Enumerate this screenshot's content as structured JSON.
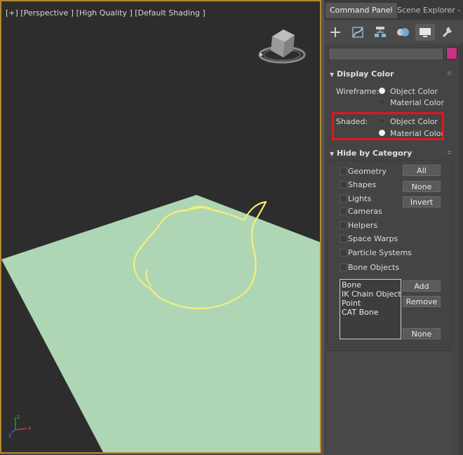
{
  "viewport": {
    "label": "[+] [Perspective ] [High Quality ] [Default Shading ]",
    "colors": {
      "background": "#2d2d2d",
      "ground_plane": "#aed6b4",
      "wire_outline": "#f2ef7a",
      "frame": "#b08a2e"
    },
    "axes": {
      "x": "x",
      "y": "y",
      "z": "z"
    }
  },
  "panel": {
    "tabs": [
      {
        "label": "Command Panel",
        "active": true
      },
      {
        "label": "Scene Explorer - De",
        "active": false
      }
    ],
    "tools": [
      {
        "icon": "create-icon"
      },
      {
        "icon": "modify-icon"
      },
      {
        "icon": "hierarchy-icon"
      },
      {
        "icon": "motion-icon"
      },
      {
        "icon": "display-icon",
        "active": true
      },
      {
        "icon": "utilities-icon"
      }
    ],
    "object_color": "#c2347f",
    "display_color": {
      "title": "Display Color",
      "wireframe_label": "Wireframe:",
      "wireframe_options": [
        {
          "label": "Object Color",
          "selected": true
        },
        {
          "label": "Material Color",
          "selected": false
        }
      ],
      "shaded_label": "Shaded:",
      "shaded_options": [
        {
          "label": "Object Color",
          "selected": false
        },
        {
          "label": "Material Color",
          "selected": true
        }
      ],
      "highlight_color": "#e0161e"
    },
    "hide_by_category": {
      "title": "Hide by Category",
      "categories": [
        "Geometry",
        "Shapes",
        "Lights",
        "Cameras",
        "Helpers",
        "Space Warps",
        "Particle Systems",
        "Bone Objects"
      ],
      "buttons": {
        "all": "All",
        "none": "None",
        "invert": "Invert"
      },
      "list_items": [
        "Bone",
        "IK Chain Object",
        "Point",
        "CAT Bone"
      ],
      "list_buttons": {
        "add": "Add",
        "remove": "Remove",
        "none": "None"
      }
    }
  }
}
